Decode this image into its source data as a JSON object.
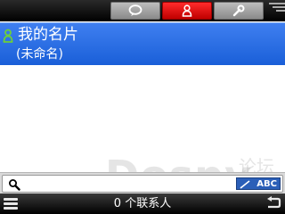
{
  "top_tabs": [
    {
      "name": "chat",
      "icon": "speech-bubble-icon",
      "active": false
    },
    {
      "name": "contacts",
      "icon": "person-icon",
      "active": true
    },
    {
      "name": "tools",
      "icon": "wrench-icon",
      "active": false
    }
  ],
  "contact_card": {
    "name": "我的名片",
    "subtitle": "(未命名)"
  },
  "search": {
    "value": "",
    "input_mode": "ABC"
  },
  "status": {
    "contacts_count_text": "0 个联系人"
  },
  "watermark": {
    "text": "Dospy",
    "text_cn": "论坛"
  },
  "colors": {
    "accent_blue": "#1a5fd8",
    "active_tab_red": "#e00000",
    "bar_black": "#000000"
  }
}
